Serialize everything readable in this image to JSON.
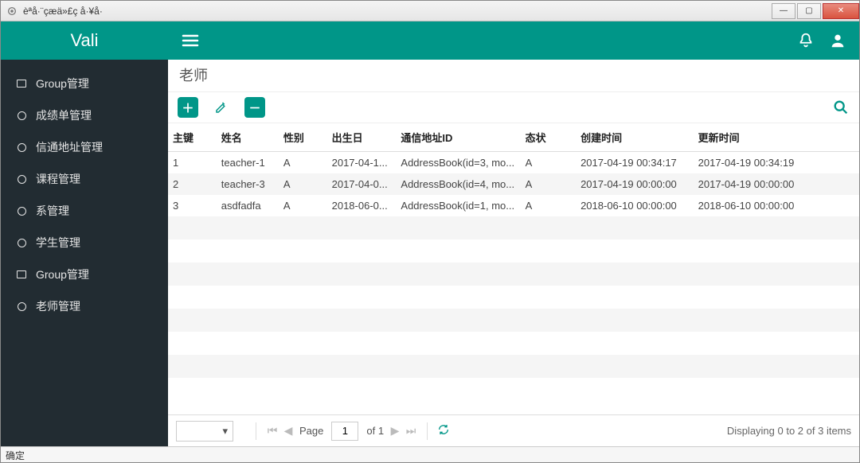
{
  "window": {
    "title": "èªå·¨çæä»£ç å·¥å·"
  },
  "brand": "Vali",
  "sidebar": {
    "items": [
      {
        "label": "Group管理",
        "icon": "box"
      },
      {
        "label": "成绩单管理",
        "icon": "circle"
      },
      {
        "label": "信通地址管理",
        "icon": "circle"
      },
      {
        "label": "课程管理",
        "icon": "circle"
      },
      {
        "label": "系管理",
        "icon": "circle"
      },
      {
        "label": "学生管理",
        "icon": "circle"
      },
      {
        "label": "Group管理",
        "icon": "box"
      },
      {
        "label": "老师管理",
        "icon": "circle"
      }
    ]
  },
  "page": {
    "title": "老师"
  },
  "table": {
    "columns": [
      "主键",
      "姓名",
      "性别",
      "出生日",
      "通信地址ID",
      "态状",
      "创建时间",
      "更新时间"
    ],
    "rows": [
      {
        "id": "1",
        "name": "teacher-1",
        "gender": "A",
        "birth": "2017-04-1...",
        "addr": "AddressBook(id=3, mo...",
        "status": "A",
        "created": "2017-04-19 00:34:17",
        "updated": "2017-04-19 00:34:19"
      },
      {
        "id": "2",
        "name": "teacher-3",
        "gender": "A",
        "birth": "2017-04-0...",
        "addr": "AddressBook(id=4, mo...",
        "status": "A",
        "created": "2017-04-19 00:00:00",
        "updated": "2017-04-19 00:00:00"
      },
      {
        "id": "3",
        "name": "asdfadfa",
        "gender": "A",
        "birth": "2018-06-0...",
        "addr": "AddressBook(id=1, mo...",
        "status": "A",
        "created": "2018-06-10 00:00:00",
        "updated": "2018-06-10 00:00:00"
      }
    ]
  },
  "pager": {
    "page_label": "Page",
    "page_value": "1",
    "of_label": "of 1",
    "info": "Displaying 0 to 2 of 3 items"
  },
  "statusbar": {
    "text": "确定"
  }
}
